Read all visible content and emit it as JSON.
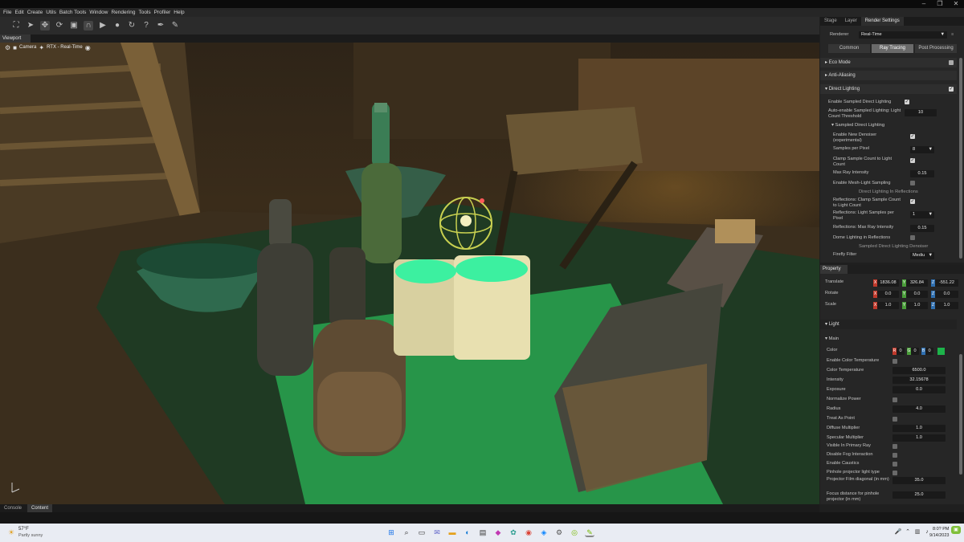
{
  "window": {
    "minimize": "–",
    "maximize": "❐",
    "close": "✕"
  },
  "menu": [
    "File",
    "Edit",
    "Create",
    "Utils",
    "Batch Tools",
    "Window",
    "Rendering",
    "Tools",
    "Profiler",
    "Help"
  ],
  "viewport": {
    "tab": "Viewport",
    "camera": "Camera",
    "rtx": "RTX - Real-Time"
  },
  "right_tabs": [
    "Stage",
    "Layer",
    "Render Settings"
  ],
  "renderer": {
    "label": "Renderer",
    "value": "Real-Time"
  },
  "mode_tabs": [
    "Common",
    "Ray Tracing",
    "Post Processing"
  ],
  "sections": {
    "eco": "Eco Mode",
    "aa": "Anti-Aliasing",
    "dl": "Direct Lighting"
  },
  "dl": {
    "enable_sampled": "Enable Sampled Direct Lighting",
    "auto_enable": "Auto-enable Sampled Lighting: Light Count Threshold",
    "auto_value": "10",
    "sampled_title": "Sampled Direct Lighting",
    "new_denoiser": "Enable New Denoiser (experimental)",
    "spp": "Samples per Pixel",
    "spp_value": "8",
    "clamp": "Clamp Sample Count to Light Count",
    "max_ray": "Max Ray Intensity",
    "max_ray_value": "0.15",
    "mesh_light": "Enable Mesh-Light Sampling",
    "refl_title": "Direct Lighting In Reflections",
    "refl_clamp": "Reflections: Clamp Sample Count to Light Count",
    "refl_spp": "Reflections: Light Samples per Pixel",
    "refl_spp_value": "1",
    "refl_max": "Reflections: Max Ray Intensity",
    "refl_max_value": "0.15",
    "dome_refl": "Dome Lighting in Reflections",
    "denoiser_title": "Sampled Direct Lighting Denoiser",
    "firefly": "Firefly Filter",
    "firefly_value": "Mediu"
  },
  "property": {
    "tab": "Property",
    "translate": {
      "label": "Translate",
      "x": "1836.08",
      "y": "326.84",
      "z": "-551.22"
    },
    "rotate": {
      "label": "Rotate",
      "x": "0.0",
      "y": "0.0",
      "z": "0.0"
    },
    "scale": {
      "label": "Scale",
      "x": "1.0",
      "y": "1.0",
      "z": "1.0"
    },
    "light": "Light",
    "main": "Main",
    "color": {
      "label": "Color",
      "r": "0",
      "g": "0",
      "b": "0"
    },
    "rows": [
      {
        "label": "Enable Color Temperature",
        "type": "chk",
        "value": ""
      },
      {
        "label": "Color Temperature",
        "type": "num",
        "value": "6500.0"
      },
      {
        "label": "Intensity",
        "type": "num",
        "value": "32.15678"
      },
      {
        "label": "Exposure",
        "type": "num",
        "value": "0.0"
      },
      {
        "label": "Normalize Power",
        "type": "chk",
        "value": ""
      },
      {
        "label": "Radius",
        "type": "num",
        "value": "4.0"
      },
      {
        "label": "Treat As Point",
        "type": "chk",
        "value": ""
      },
      {
        "label": "Diffuse Multiplier",
        "type": "num",
        "value": "1.0"
      },
      {
        "label": "Specular Multiplier",
        "type": "num",
        "value": "1.0"
      },
      {
        "label": "Visible In Primary Ray",
        "type": "chk",
        "value": ""
      },
      {
        "label": "Disable Fog Interaction",
        "type": "chk",
        "value": ""
      },
      {
        "label": "Enable Caustics",
        "type": "chk",
        "value": ""
      },
      {
        "label": "Pinhole projector light type",
        "type": "chk",
        "value": ""
      }
    ],
    "proj_film": {
      "label": "Projector Film diagonal (in mm)",
      "value": "35.0"
    },
    "focus": {
      "label": "Focus distance for pinhole projector (in mm)",
      "value": "25.0"
    }
  },
  "bottom_tabs": [
    "Console",
    "Content"
  ],
  "weather": {
    "temp": "57°F",
    "desc": "Partly sunny"
  },
  "clock": {
    "time": "8:0? PM",
    "date": "9/14/2023"
  },
  "colors": {
    "accent": "#76b900",
    "green_light": "#28ff6e"
  }
}
